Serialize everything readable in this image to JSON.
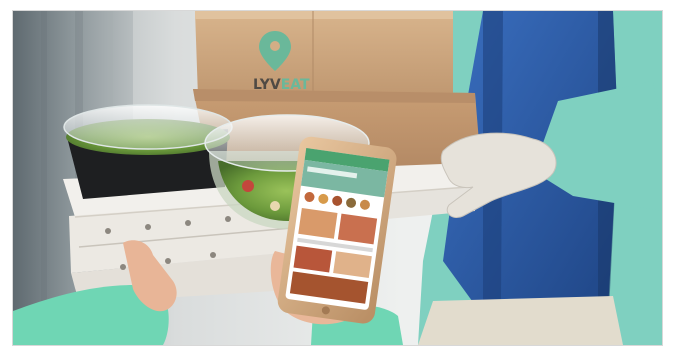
{
  "photo": {
    "description_icon": "food-delivery-handoff-photo",
    "brand": {
      "name_part1": "LYV",
      "name_part2": "EAT",
      "logo_icon": "location-pin-icon"
    },
    "colors": {
      "box_cardboard": "#c8a27a",
      "box_shadow": "#a98462",
      "brand_green": "#6ab89a",
      "vest_blue": "#2d5aa6",
      "shirt_teal": "#7fd0c0",
      "sleeve_mint": "#6fd6b4",
      "pizza_box": "#f2f0ec",
      "app_green": "#4aa36f"
    }
  }
}
